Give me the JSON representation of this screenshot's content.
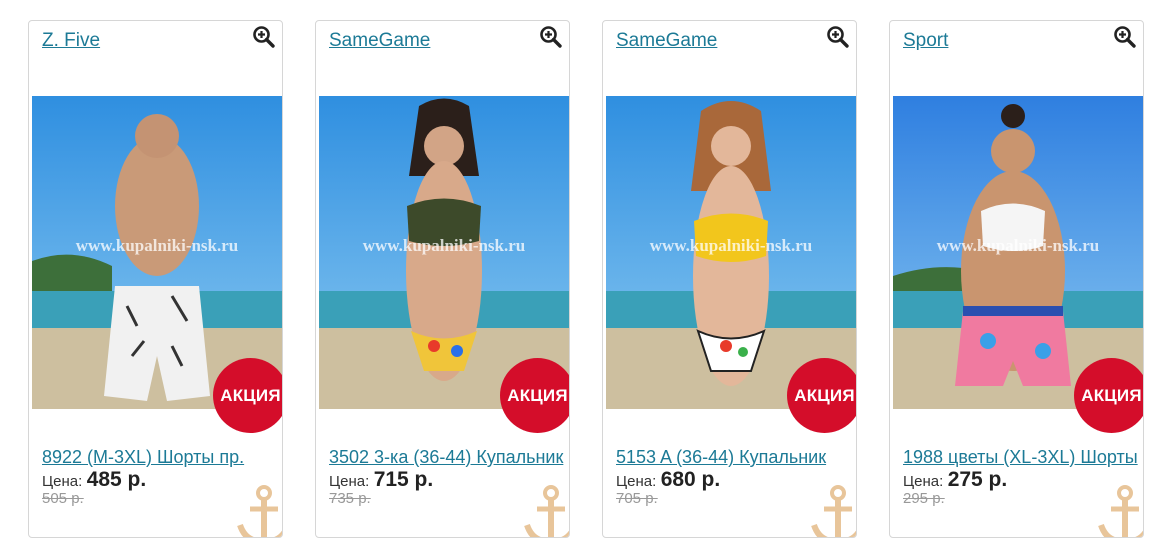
{
  "currency_label": "Цена:",
  "sale_badge": "АКЦИЯ",
  "watermark": "www.kupalniki-nsk.ru",
  "colors": {
    "link": "#1c7a96",
    "badge": "#d40d2a",
    "anchor": "#e8c59a"
  },
  "products": [
    {
      "brand": "Z. Five",
      "title": "8922 (M-3XL) Шорты пр.",
      "price": "485 р.",
      "old_price": "505 р.",
      "image": "man-in-swim-shorts"
    },
    {
      "brand": "SameGame",
      "title": "3502 3-ка (36-44) Купальник",
      "price": "715 р.",
      "old_price": "735 р.",
      "image": "woman-in-bikini"
    },
    {
      "brand": "SameGame",
      "title": "5153 A (36-44) Купальник",
      "price": "680 р.",
      "old_price": "705 р.",
      "image": "woman-in-yellow-bikini"
    },
    {
      "brand": "Sport",
      "title": "1988 цветы (XL-3XL) Шорты",
      "price": "275 р.",
      "old_price": "295 р.",
      "image": "woman-in-floral-shorts"
    }
  ]
}
